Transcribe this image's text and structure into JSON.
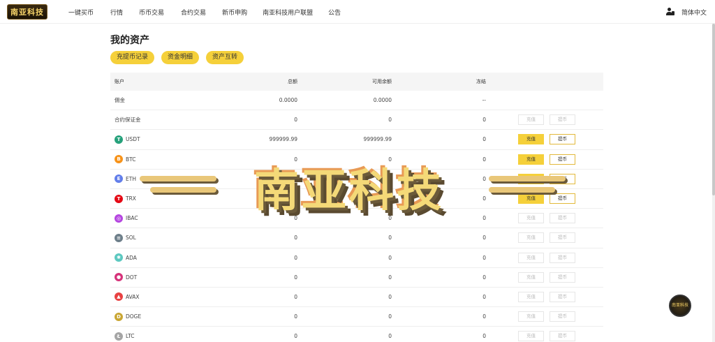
{
  "header": {
    "logo_text": "南亚科技",
    "nav": [
      "一键买币",
      "行情",
      "币币交易",
      "合约交易",
      "新币申购",
      "南亚科技用户联盟",
      "公告"
    ],
    "language": "简体中文"
  },
  "page": {
    "title": "我的资产",
    "buttons": [
      "充提币记录",
      "资金明细",
      "资产互转"
    ]
  },
  "table": {
    "headers": {
      "account": "账户",
      "total": "总额",
      "available": "可用余额",
      "frozen": "冻结"
    },
    "deposit_label": "充值",
    "withdraw_label": "提币",
    "rows": [
      {
        "name": "佣金",
        "total": "0.0000",
        "available": "0.0000",
        "frozen": "--",
        "icon": "",
        "ops": false
      },
      {
        "name": "合约保证金",
        "total": "0",
        "available": "0",
        "frozen": "0",
        "icon": "",
        "ops": true,
        "active": false
      },
      {
        "name": "USDT",
        "total": "999999.99",
        "available": "999999.99",
        "frozen": "0",
        "icon": "usdt-icon",
        "color": "#26a17b",
        "glyph": "T",
        "ops": true,
        "active": true
      },
      {
        "name": "BTC",
        "total": "0",
        "available": "0",
        "frozen": "0",
        "icon": "btc-icon",
        "color": "#f7931a",
        "glyph": "B",
        "ops": true,
        "active": true
      },
      {
        "name": "ETH",
        "total": "0",
        "available": "0",
        "frozen": "0",
        "icon": "eth-icon",
        "color": "#627eea",
        "glyph": "E",
        "ops": true,
        "active": true
      },
      {
        "name": "TRX",
        "total": "0",
        "available": "0",
        "frozen": "0",
        "icon": "trx-icon",
        "color": "#e50915",
        "glyph": "T",
        "ops": true,
        "active": true
      },
      {
        "name": "IBAC",
        "total": "0",
        "available": "0",
        "frozen": "0",
        "icon": "ibac-icon",
        "color": "#b546e0",
        "glyph": "◎",
        "ops": true,
        "active": false
      },
      {
        "name": "SOL",
        "total": "0",
        "available": "0",
        "frozen": "0",
        "icon": "sol-icon",
        "color": "#6e7f8a",
        "glyph": "≡",
        "ops": true,
        "active": false
      },
      {
        "name": "ADA",
        "total": "0",
        "available": "0",
        "frozen": "0",
        "icon": "ada-icon",
        "color": "#5cc8c0",
        "glyph": "✱",
        "ops": true,
        "active": false
      },
      {
        "name": "DOT",
        "total": "0",
        "available": "0",
        "frozen": "0",
        "icon": "dot-icon",
        "color": "#d6337a",
        "glyph": "●",
        "ops": true,
        "active": false
      },
      {
        "name": "AVAX",
        "total": "0",
        "available": "0",
        "frozen": "0",
        "icon": "avax-icon",
        "color": "#e84142",
        "glyph": "▲",
        "ops": true,
        "active": false
      },
      {
        "name": "DOGE",
        "total": "0",
        "available": "0",
        "frozen": "0",
        "icon": "doge-icon",
        "color": "#c9a633",
        "glyph": "D",
        "ops": true,
        "active": false
      },
      {
        "name": "LTC",
        "total": "0",
        "available": "0",
        "frozen": "0",
        "icon": "ltc-icon",
        "color": "#a5a5a5",
        "glyph": "Ł",
        "ops": true,
        "active": false
      }
    ]
  },
  "watermark": {
    "text": "南亚科技"
  },
  "float_button": {
    "text": "南亚科技"
  }
}
